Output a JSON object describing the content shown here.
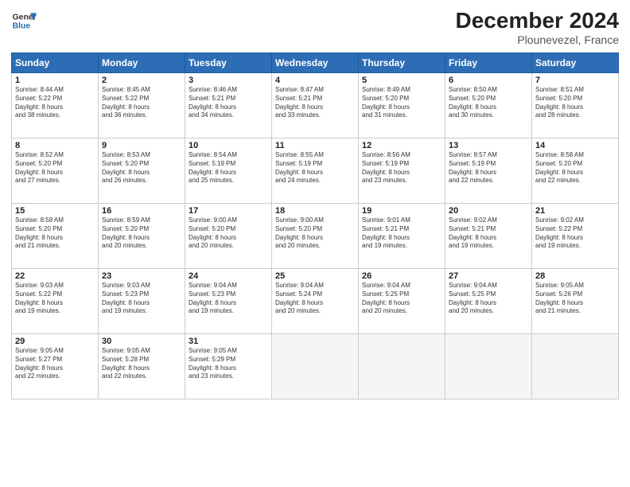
{
  "header": {
    "logo_line1": "General",
    "logo_line2": "Blue",
    "month": "December 2024",
    "location": "Plounevezel, France"
  },
  "weekdays": [
    "Sunday",
    "Monday",
    "Tuesday",
    "Wednesday",
    "Thursday",
    "Friday",
    "Saturday"
  ],
  "weeks": [
    [
      {
        "day": "1",
        "info": "Sunrise: 8:44 AM\nSunset: 5:22 PM\nDaylight: 8 hours\nand 38 minutes."
      },
      {
        "day": "2",
        "info": "Sunrise: 8:45 AM\nSunset: 5:22 PM\nDaylight: 8 hours\nand 36 minutes."
      },
      {
        "day": "3",
        "info": "Sunrise: 8:46 AM\nSunset: 5:21 PM\nDaylight: 8 hours\nand 34 minutes."
      },
      {
        "day": "4",
        "info": "Sunrise: 8:47 AM\nSunset: 5:21 PM\nDaylight: 8 hours\nand 33 minutes."
      },
      {
        "day": "5",
        "info": "Sunrise: 8:49 AM\nSunset: 5:20 PM\nDaylight: 8 hours\nand 31 minutes."
      },
      {
        "day": "6",
        "info": "Sunrise: 8:50 AM\nSunset: 5:20 PM\nDaylight: 8 hours\nand 30 minutes."
      },
      {
        "day": "7",
        "info": "Sunrise: 8:51 AM\nSunset: 5:20 PM\nDaylight: 8 hours\nand 28 minutes."
      }
    ],
    [
      {
        "day": "8",
        "info": "Sunrise: 8:52 AM\nSunset: 5:20 PM\nDaylight: 8 hours\nand 27 minutes."
      },
      {
        "day": "9",
        "info": "Sunrise: 8:53 AM\nSunset: 5:20 PM\nDaylight: 8 hours\nand 26 minutes."
      },
      {
        "day": "10",
        "info": "Sunrise: 8:54 AM\nSunset: 5:19 PM\nDaylight: 8 hours\nand 25 minutes."
      },
      {
        "day": "11",
        "info": "Sunrise: 8:55 AM\nSunset: 5:19 PM\nDaylight: 8 hours\nand 24 minutes."
      },
      {
        "day": "12",
        "info": "Sunrise: 8:56 AM\nSunset: 5:19 PM\nDaylight: 8 hours\nand 23 minutes."
      },
      {
        "day": "13",
        "info": "Sunrise: 8:57 AM\nSunset: 5:19 PM\nDaylight: 8 hours\nand 22 minutes."
      },
      {
        "day": "14",
        "info": "Sunrise: 8:58 AM\nSunset: 5:20 PM\nDaylight: 8 hours\nand 22 minutes."
      }
    ],
    [
      {
        "day": "15",
        "info": "Sunrise: 8:58 AM\nSunset: 5:20 PM\nDaylight: 8 hours\nand 21 minutes."
      },
      {
        "day": "16",
        "info": "Sunrise: 8:59 AM\nSunset: 5:20 PM\nDaylight: 8 hours\nand 20 minutes."
      },
      {
        "day": "17",
        "info": "Sunrise: 9:00 AM\nSunset: 5:20 PM\nDaylight: 8 hours\nand 20 minutes."
      },
      {
        "day": "18",
        "info": "Sunrise: 9:00 AM\nSunset: 5:20 PM\nDaylight: 8 hours\nand 20 minutes."
      },
      {
        "day": "19",
        "info": "Sunrise: 9:01 AM\nSunset: 5:21 PM\nDaylight: 8 hours\nand 19 minutes."
      },
      {
        "day": "20",
        "info": "Sunrise: 9:02 AM\nSunset: 5:21 PM\nDaylight: 8 hours\nand 19 minutes."
      },
      {
        "day": "21",
        "info": "Sunrise: 9:02 AM\nSunset: 5:22 PM\nDaylight: 8 hours\nand 19 minutes."
      }
    ],
    [
      {
        "day": "22",
        "info": "Sunrise: 9:03 AM\nSunset: 5:22 PM\nDaylight: 8 hours\nand 19 minutes."
      },
      {
        "day": "23",
        "info": "Sunrise: 9:03 AM\nSunset: 5:23 PM\nDaylight: 8 hours\nand 19 minutes."
      },
      {
        "day": "24",
        "info": "Sunrise: 9:04 AM\nSunset: 5:23 PM\nDaylight: 8 hours\nand 19 minutes."
      },
      {
        "day": "25",
        "info": "Sunrise: 9:04 AM\nSunset: 5:24 PM\nDaylight: 8 hours\nand 20 minutes."
      },
      {
        "day": "26",
        "info": "Sunrise: 9:04 AM\nSunset: 5:25 PM\nDaylight: 8 hours\nand 20 minutes."
      },
      {
        "day": "27",
        "info": "Sunrise: 9:04 AM\nSunset: 5:25 PM\nDaylight: 8 hours\nand 20 minutes."
      },
      {
        "day": "28",
        "info": "Sunrise: 9:05 AM\nSunset: 5:26 PM\nDaylight: 8 hours\nand 21 minutes."
      }
    ],
    [
      {
        "day": "29",
        "info": "Sunrise: 9:05 AM\nSunset: 5:27 PM\nDaylight: 8 hours\nand 22 minutes."
      },
      {
        "day": "30",
        "info": "Sunrise: 9:05 AM\nSunset: 5:28 PM\nDaylight: 8 hours\nand 22 minutes."
      },
      {
        "day": "31",
        "info": "Sunrise: 9:05 AM\nSunset: 5:29 PM\nDaylight: 8 hours\nand 23 minutes."
      },
      {
        "day": "",
        "info": ""
      },
      {
        "day": "",
        "info": ""
      },
      {
        "day": "",
        "info": ""
      },
      {
        "day": "",
        "info": ""
      }
    ]
  ]
}
